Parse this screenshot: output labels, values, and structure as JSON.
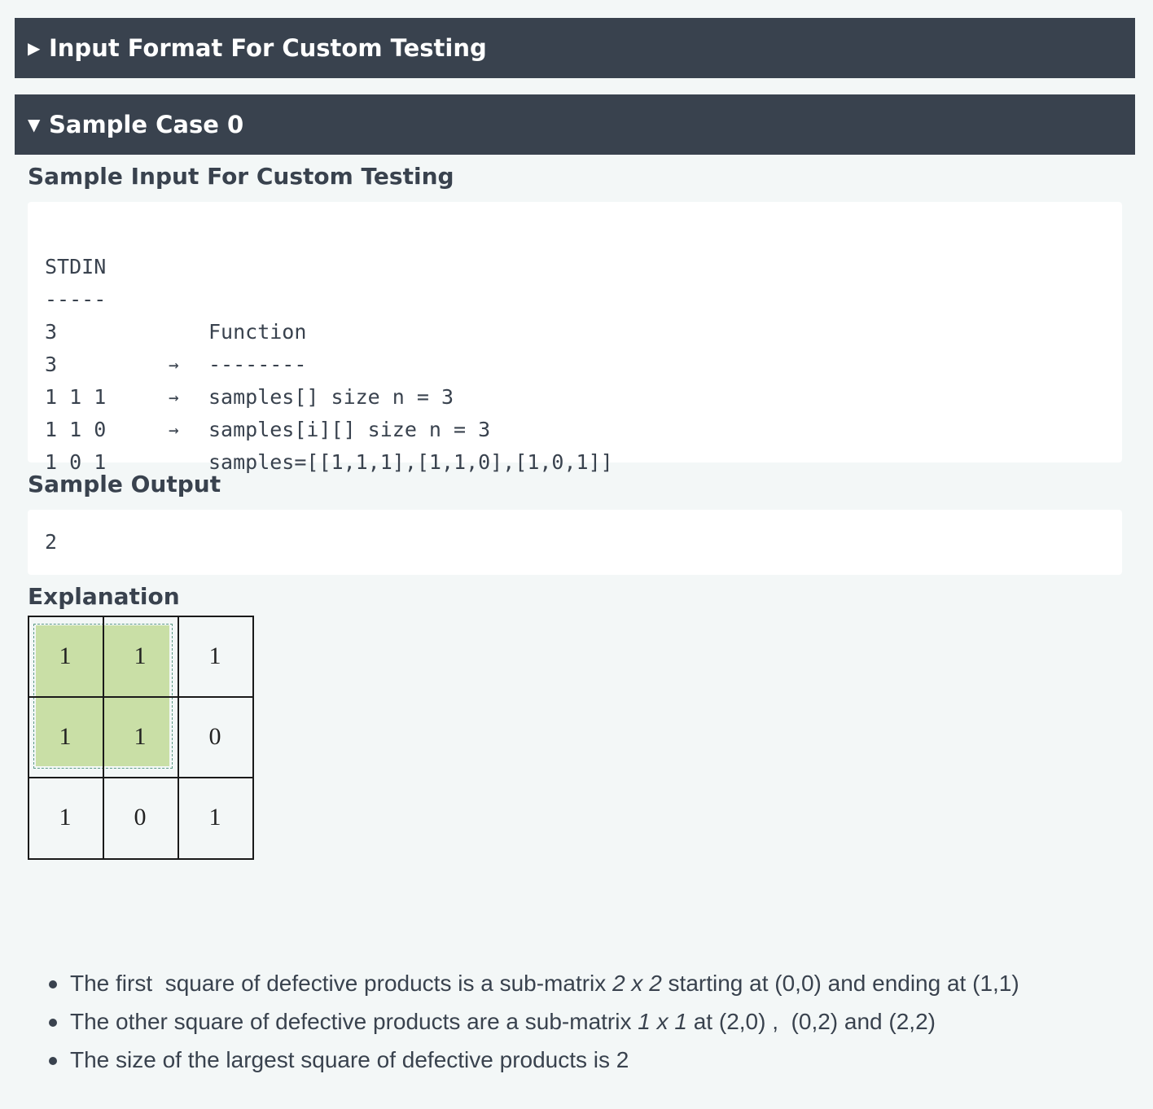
{
  "sections": {
    "input_format": {
      "toggle_icon": "triangle-right",
      "title": "Input Format For Custom Testing",
      "expanded": false
    },
    "sample_case": {
      "toggle_icon": "triangle-down",
      "title": "Sample Case 0",
      "expanded": true
    }
  },
  "sample_input": {
    "heading": "Sample Input For Custom Testing",
    "lines": [
      {
        "stdin": "STDIN",
        "arrow": "",
        "func": "Function"
      },
      {
        "stdin": "-----",
        "arrow": "",
        "func": "--------"
      },
      {
        "stdin": "3",
        "arrow": "→",
        "func": "samples[] size n = 3"
      },
      {
        "stdin": "3",
        "arrow": "→",
        "func": "samples[i][] size n = 3"
      },
      {
        "stdin": "1 1 1",
        "arrow": "→",
        "func": "samples=[[1,1,1],[1,1,0],[1,0,1]]"
      },
      {
        "stdin": "1 1 0",
        "arrow": "",
        "func": ""
      },
      {
        "stdin": "1 0 1",
        "arrow": "",
        "func": ""
      }
    ]
  },
  "sample_output": {
    "heading": "Sample Output",
    "value": "2"
  },
  "explanation": {
    "heading": "Explanation",
    "matrix": [
      [
        "1",
        "1",
        "1"
      ],
      [
        "1",
        "1",
        "0"
      ],
      [
        "1",
        "0",
        "1"
      ]
    ],
    "highlight_color": "#c9dfa6",
    "bullets": [
      {
        "a": "The first  square of defective products is a sub-matrix ",
        "em": "2 x 2",
        "b": " starting at (0,0) and ending at (1,1)"
      },
      {
        "a": "The other square of defective products are a sub-matrix ",
        "em": "1 x 1",
        "b": " at (2,0) ,  (0,2) and (2,2)"
      },
      {
        "a": "The size of the largest square of defective products is 2",
        "em": "",
        "b": ""
      }
    ]
  }
}
